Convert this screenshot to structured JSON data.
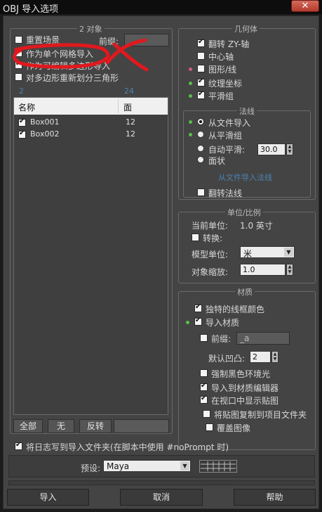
{
  "window": {
    "title": "OBJ 导入选项",
    "close_glyph": "✕"
  },
  "objects_group": {
    "title": "2 对象",
    "reset_scene": "重置场景",
    "prefix_label": "前缀:",
    "import_single_mesh": "作为单个网格导入",
    "import_editable_poly": "作为可编辑多边形导入",
    "retriangulate": "对多边形重新划分三角形",
    "faded_left": "2",
    "faded_right": "24",
    "list": {
      "col_name": "名称",
      "col_faces": "面",
      "rows": [
        {
          "name": "Box001",
          "faces": "12",
          "checked": true
        },
        {
          "name": "Box002",
          "faces": "12",
          "checked": true
        }
      ]
    },
    "btn_all": "全部",
    "btn_none": "无",
    "btn_invert": "反转"
  },
  "geometry_group": {
    "title": "几何体",
    "flip_zy": "翻转 ZY-轴",
    "center_pivot": "中心轴",
    "shapes": "图形/线",
    "texture_coords": "纹理坐标",
    "smoothing_groups": "平滑组"
  },
  "normals_group": {
    "title": "法线",
    "from_file": "从文件导入",
    "from_smoothing": "从平滑组",
    "auto_smooth": "自动平滑:",
    "auto_smooth_value": "30.0",
    "faceted": "面状",
    "faded_note": "从文件导入法线",
    "flip_normals": "翻转法线"
  },
  "units_group": {
    "title": "单位/比例",
    "current_units_label": "当前单位:",
    "current_units_value": "1.0 英寸",
    "convert": "转换:",
    "model_units_label": "模型单位:",
    "model_units_value": "米",
    "object_scale_label": "对象缩放:",
    "object_scale_value": "1.0"
  },
  "materials_group": {
    "title": "材质",
    "unique_wire_color": "独特的线框颜色",
    "import_materials": "导入材质",
    "prefix_label": "前缀:",
    "prefix_value": "_a",
    "default_bump_label": "默认凹凸:",
    "default_bump_value": "2",
    "force_black_ambient": "强制黑色环境光",
    "import_to_editor": "导入到材质编辑器",
    "show_maps_in_viewport": "在视口中显示贴图",
    "copy_maps_to_project": "将贴图复制到项目文件夹",
    "overwrite_images": "覆盖图像"
  },
  "footer": {
    "log_label": "将日志写到导入文件夹(在脚本中使用 #noPrompt 时)",
    "preset_label": "预设:",
    "preset_value": "Maya",
    "btn_import": "导入",
    "btn_cancel": "取消",
    "btn_help": "帮助"
  },
  "annotation_color": "#e0191e"
}
